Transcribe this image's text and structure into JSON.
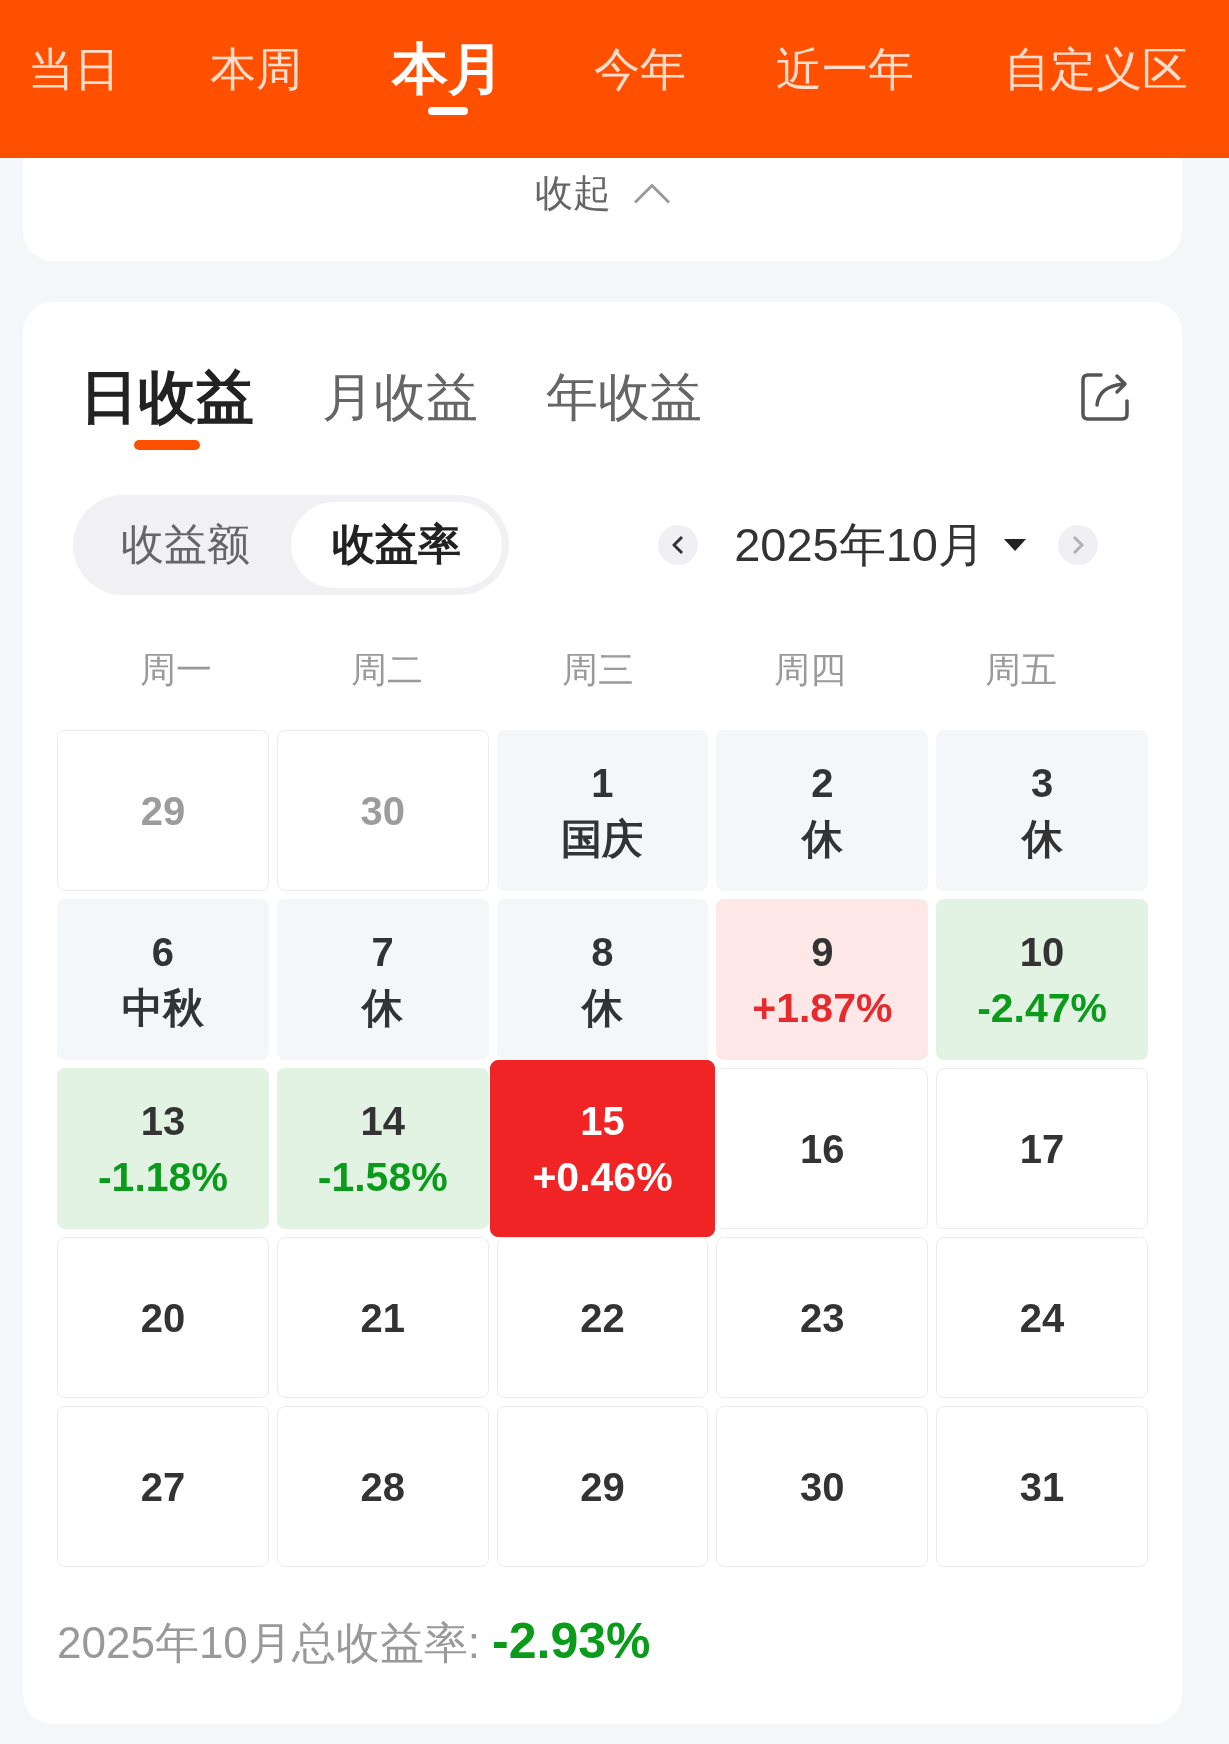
{
  "period_tabs": [
    {
      "label": "当日",
      "selected": false
    },
    {
      "label": "本周",
      "selected": false
    },
    {
      "label": "本月",
      "selected": true
    },
    {
      "label": "今年",
      "selected": false
    },
    {
      "label": "近一年",
      "selected": false
    },
    {
      "label": "自定义区",
      "selected": false
    }
  ],
  "collapse": {
    "label": "收起"
  },
  "earnings_tabs": [
    {
      "label": "日收益",
      "selected": true
    },
    {
      "label": "月收益",
      "selected": false
    },
    {
      "label": "年收益",
      "selected": false
    }
  ],
  "metric_toggle": [
    {
      "label": "收益额",
      "selected": false
    },
    {
      "label": "收益率",
      "selected": true
    }
  ],
  "month_picker": {
    "value": "2025年10月",
    "prev_disabled": false,
    "next_disabled": true
  },
  "calendar": {
    "weekdays": [
      "周一",
      "周二",
      "周三",
      "周四",
      "周五"
    ],
    "days": [
      {
        "day": "29",
        "kind": "other_month",
        "selected": false
      },
      {
        "day": "30",
        "kind": "other_month",
        "selected": false
      },
      {
        "day": "1",
        "note": "国庆",
        "kind": "holiday",
        "selected": false
      },
      {
        "day": "2",
        "note": "休",
        "kind": "holiday",
        "selected": false
      },
      {
        "day": "3",
        "note": "休",
        "kind": "holiday",
        "selected": false
      },
      {
        "day": "6",
        "note": "中秋",
        "kind": "holiday",
        "selected": false
      },
      {
        "day": "7",
        "note": "休",
        "kind": "holiday",
        "selected": false
      },
      {
        "day": "8",
        "note": "休",
        "kind": "holiday",
        "selected": false
      },
      {
        "day": "9",
        "note": "+1.87%",
        "kind": "up",
        "selected": false
      },
      {
        "day": "10",
        "note": "-2.47%",
        "kind": "down",
        "selected": false
      },
      {
        "day": "13",
        "note": "-1.18%",
        "kind": "down",
        "selected": false
      },
      {
        "day": "14",
        "note": "-1.58%",
        "kind": "down",
        "selected": false
      },
      {
        "day": "15",
        "note": "+0.46%",
        "kind": "up",
        "selected": true
      },
      {
        "day": "16",
        "kind": "future",
        "selected": false
      },
      {
        "day": "17",
        "kind": "future",
        "selected": false
      },
      {
        "day": "20",
        "kind": "future",
        "selected": false
      },
      {
        "day": "21",
        "kind": "future",
        "selected": false
      },
      {
        "day": "22",
        "kind": "future",
        "selected": false
      },
      {
        "day": "23",
        "kind": "future",
        "selected": false
      },
      {
        "day": "24",
        "kind": "future",
        "selected": false
      },
      {
        "day": "27",
        "kind": "future",
        "selected": false
      },
      {
        "day": "28",
        "kind": "future",
        "selected": false
      },
      {
        "day": "29",
        "kind": "future",
        "selected": false
      },
      {
        "day": "30",
        "kind": "future",
        "selected": false
      },
      {
        "day": "31",
        "kind": "future",
        "selected": false
      }
    ]
  },
  "summary": {
    "label": "2025年10月总收益率:",
    "value": "-2.93%",
    "rising": false
  }
}
